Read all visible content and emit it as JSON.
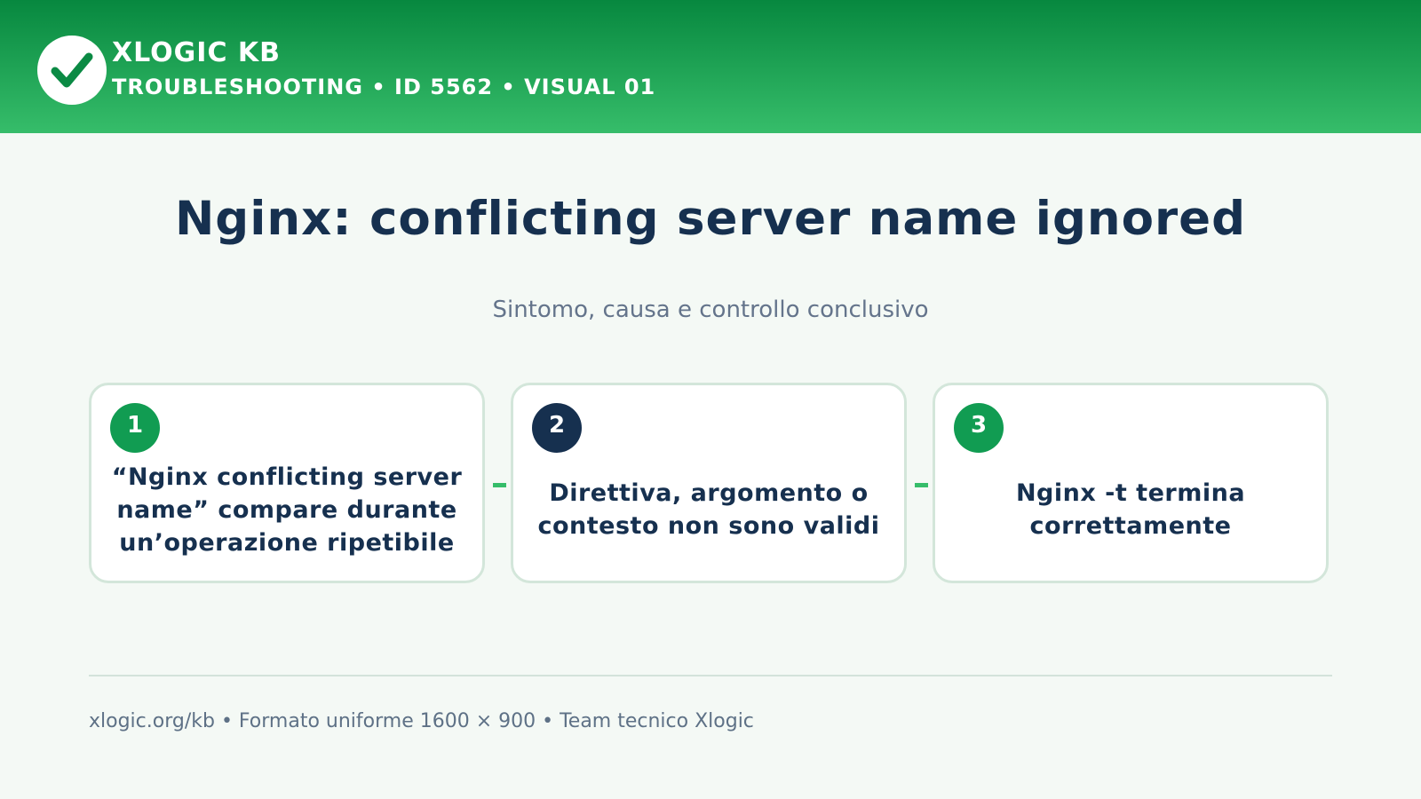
{
  "header": {
    "brand": "XLOGIC KB",
    "subtitle": "TROUBLESHOOTING • ID 5562 • VISUAL 01",
    "logo_icon": "checkmark-icon"
  },
  "title": "Nginx: conflicting server name ignored",
  "subtitle": "Sintomo, causa e controllo conclusivo",
  "steps": [
    {
      "number": "1",
      "text": "“Nginx conflicting server name” compare durante un’operazione ripetibile",
      "badge_color": "#119c52"
    },
    {
      "number": "2",
      "text": "Direttiva, argomento o contesto non sono validi",
      "badge_color": "#16304f"
    },
    {
      "number": "3",
      "text": "Nginx -t termina correttamente",
      "badge_color": "#119c52"
    }
  ],
  "footer": "xlogic.org/kb • Formato uniforme 1600 × 900 • Team tecnico Xlogic",
  "colors": {
    "header_gradient_top": "#07883f",
    "header_gradient_bottom": "#36bd6a",
    "title": "#16304f",
    "accent": "#36bd6a"
  }
}
